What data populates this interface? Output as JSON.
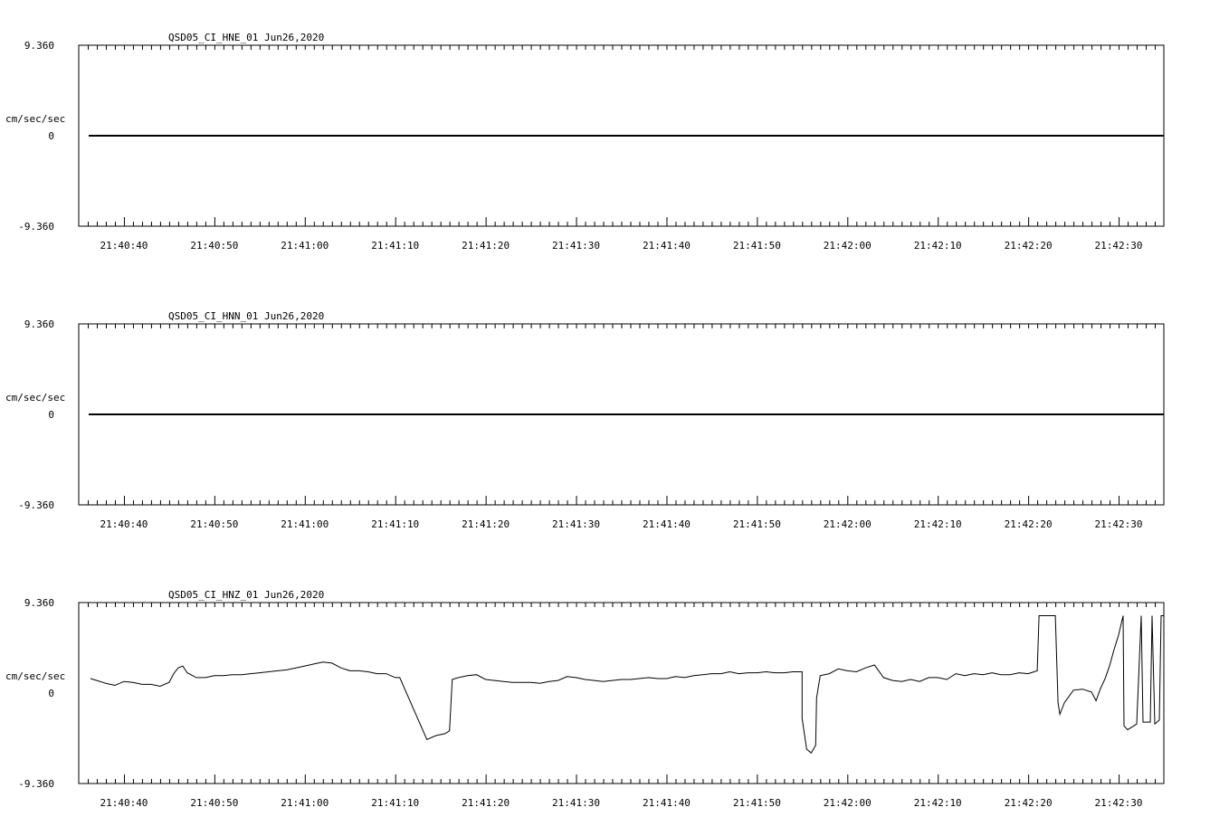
{
  "chart_data": [
    {
      "type": "line",
      "title": "QSD05_CI_HNE_01  Jun26,2020",
      "ylabel": "cm/sec/sec",
      "ylim": [
        -9.36,
        9.36
      ],
      "y_tick_labels": [
        "9.360",
        "0",
        "-9.360"
      ],
      "x_tick_labels": [
        "21:40:40",
        "21:40:50",
        "21:41:00",
        "21:41:10",
        "21:41:20",
        "21:41:30",
        "21:41:40",
        "21:41:50",
        "21:42:00",
        "21:42:10",
        "21:42:20",
        "21:42:30"
      ],
      "x_start": "21:40:35",
      "x_end": "21:42:35",
      "series": [
        {
          "values": [
            [
              0,
              0
            ],
            [
              120,
              0
            ]
          ]
        }
      ]
    },
    {
      "type": "line",
      "title": "QSD05_CI_HNN_01  Jun26,2020",
      "ylabel": "cm/sec/sec",
      "ylim": [
        -9.36,
        9.36
      ],
      "y_tick_labels": [
        "9.360",
        "0",
        "-9.360"
      ],
      "x_tick_labels": [
        "21:40:40",
        "21:40:50",
        "21:41:00",
        "21:41:10",
        "21:41:20",
        "21:41:30",
        "21:41:40",
        "21:41:50",
        "21:42:00",
        "21:42:10",
        "21:42:20",
        "21:42:30"
      ],
      "x_start": "21:40:35",
      "x_end": "21:42:35",
      "series": [
        {
          "values": [
            [
              0,
              0
            ],
            [
              120,
              0
            ]
          ]
        }
      ]
    },
    {
      "type": "line",
      "title": "QSD05_CI_HNZ_01  Jun26,2020",
      "ylabel": "cm/sec/sec",
      "ylim": [
        -9.36,
        9.36
      ],
      "y_tick_labels": [
        "9.360",
        "0",
        "-9.360"
      ],
      "x_tick_labels": [
        "21:40:40",
        "21:40:50",
        "21:41:00",
        "21:41:10",
        "21:41:20",
        "21:41:30",
        "21:41:40",
        "21:41:50",
        "21:42:00",
        "21:42:10",
        "21:42:20",
        "21:42:30"
      ],
      "x_start": "21:40:35",
      "x_end": "21:42:35",
      "series": [
        {
          "values": [
            [
              1.3,
              1.5
            ],
            [
              2.0,
              1.3
            ],
            [
              3.0,
              1.0
            ],
            [
              4.0,
              0.8
            ],
            [
              5.0,
              1.2
            ],
            [
              6.0,
              1.1
            ],
            [
              7.0,
              0.9
            ],
            [
              8.0,
              0.9
            ],
            [
              9.0,
              0.7
            ],
            [
              10.0,
              1.1
            ],
            [
              10.5,
              2.0
            ],
            [
              11.0,
              2.6
            ],
            [
              11.5,
              2.8
            ],
            [
              12.0,
              2.1
            ],
            [
              13.0,
              1.6
            ],
            [
              14.0,
              1.6
            ],
            [
              15.0,
              1.8
            ],
            [
              16.0,
              1.8
            ],
            [
              17.0,
              1.9
            ],
            [
              18.0,
              1.9
            ],
            [
              19.0,
              2.0
            ],
            [
              20.0,
              2.1
            ],
            [
              21.0,
              2.2
            ],
            [
              22.0,
              2.3
            ],
            [
              23.0,
              2.4
            ],
            [
              24.0,
              2.6
            ],
            [
              25.0,
              2.8
            ],
            [
              26.0,
              3.0
            ],
            [
              27.0,
              3.2
            ],
            [
              28.0,
              3.1
            ],
            [
              29.0,
              2.6
            ],
            [
              30.0,
              2.3
            ],
            [
              31.0,
              2.3
            ],
            [
              32.0,
              2.2
            ],
            [
              33.0,
              2.0
            ],
            [
              34.0,
              2.0
            ],
            [
              35.0,
              1.6
            ],
            [
              35.5,
              1.6
            ],
            [
              38.5,
              -4.8
            ],
            [
              39.5,
              -4.4
            ],
            [
              40.5,
              -4.2
            ],
            [
              41.0,
              -3.9
            ],
            [
              41.3,
              1.4
            ],
            [
              42.0,
              1.6
            ],
            [
              43.0,
              1.8
            ],
            [
              44.0,
              1.9
            ],
            [
              45.0,
              1.4
            ],
            [
              46.0,
              1.3
            ],
            [
              47.0,
              1.2
            ],
            [
              48.0,
              1.1
            ],
            [
              49.0,
              1.1
            ],
            [
              50.0,
              1.1
            ],
            [
              51.0,
              1.0
            ],
            [
              52.0,
              1.2
            ],
            [
              53.0,
              1.3
            ],
            [
              54.0,
              1.7
            ],
            [
              55.0,
              1.6
            ],
            [
              56.0,
              1.4
            ],
            [
              57.0,
              1.3
            ],
            [
              58.0,
              1.2
            ],
            [
              59.0,
              1.3
            ],
            [
              60.0,
              1.4
            ],
            [
              61.0,
              1.4
            ],
            [
              62.0,
              1.5
            ],
            [
              63.0,
              1.6
            ],
            [
              64.0,
              1.5
            ],
            [
              65.0,
              1.5
            ],
            [
              66.0,
              1.7
            ],
            [
              67.0,
              1.6
            ],
            [
              68.0,
              1.8
            ],
            [
              69.0,
              1.9
            ],
            [
              70.0,
              2.0
            ],
            [
              71.0,
              2.0
            ],
            [
              72.0,
              2.2
            ],
            [
              73.0,
              2.0
            ],
            [
              74.0,
              2.1
            ],
            [
              75.0,
              2.1
            ],
            [
              76.0,
              2.2
            ],
            [
              77.0,
              2.1
            ],
            [
              78.0,
              2.1
            ],
            [
              79.0,
              2.2
            ],
            [
              80.0,
              2.2
            ],
            [
              80.0,
              -2.6
            ],
            [
              80.5,
              -5.8
            ],
            [
              81.0,
              -6.2
            ],
            [
              81.5,
              -5.4
            ],
            [
              81.6,
              -0.5
            ],
            [
              82.0,
              1.8
            ],
            [
              83.0,
              2.0
            ],
            [
              84.0,
              2.5
            ],
            [
              85.0,
              2.3
            ],
            [
              86.0,
              2.2
            ],
            [
              87.0,
              2.6
            ],
            [
              88.0,
              2.9
            ],
            [
              89.0,
              1.6
            ],
            [
              90.0,
              1.3
            ],
            [
              91.0,
              1.2
            ],
            [
              92.0,
              1.4
            ],
            [
              93.0,
              1.2
            ],
            [
              94.0,
              1.6
            ],
            [
              95.0,
              1.6
            ],
            [
              96.0,
              1.4
            ],
            [
              97.0,
              2.0
            ],
            [
              98.0,
              1.8
            ],
            [
              99.0,
              2.0
            ],
            [
              100.0,
              1.9
            ],
            [
              101.0,
              2.1
            ],
            [
              102.0,
              1.9
            ],
            [
              103.0,
              1.9
            ],
            [
              104.0,
              2.1
            ],
            [
              105.0,
              2.0
            ],
            [
              106.0,
              2.3
            ],
            [
              106.2,
              8.0
            ],
            [
              107.5,
              8.0
            ],
            [
              108.0,
              8.0
            ],
            [
              108.3,
              -1.0
            ],
            [
              108.5,
              -2.2
            ],
            [
              109.0,
              -1.0
            ],
            [
              110.0,
              0.3
            ],
            [
              111.0,
              0.4
            ],
            [
              112.0,
              0.1
            ],
            [
              112.5,
              -0.8
            ],
            [
              113.0,
              0.5
            ],
            [
              113.5,
              1.5
            ],
            [
              114.0,
              2.8
            ],
            [
              114.5,
              4.5
            ],
            [
              115.0,
              6.0
            ],
            [
              115.5,
              8.0
            ],
            [
              115.6,
              -3.4
            ],
            [
              116.0,
              -3.8
            ],
            [
              117.0,
              -3.2
            ],
            [
              117.5,
              8.0
            ],
            [
              117.7,
              -3.0
            ],
            [
              118.5,
              -3.0
            ],
            [
              118.7,
              8.0
            ],
            [
              119.0,
              -3.2
            ],
            [
              119.5,
              -2.8
            ],
            [
              119.7,
              8.0
            ],
            [
              120.0,
              8.0
            ]
          ]
        }
      ]
    }
  ]
}
